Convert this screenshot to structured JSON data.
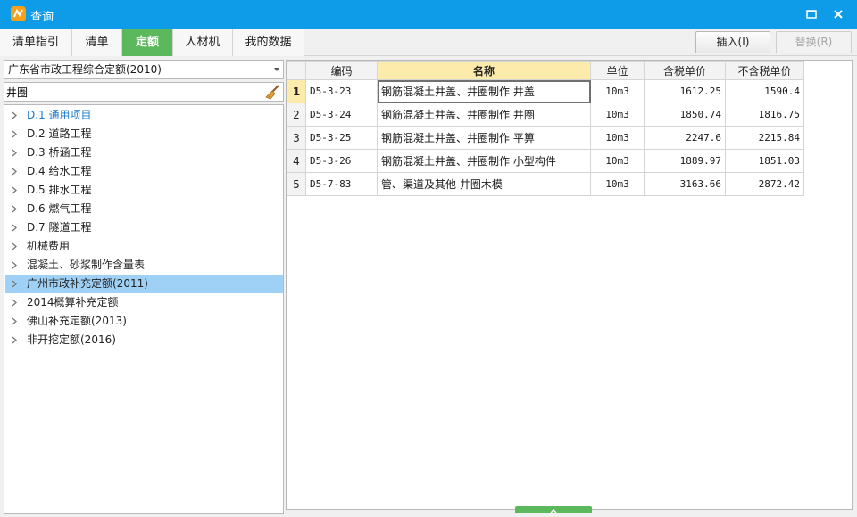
{
  "window": {
    "title": "查询"
  },
  "tabs": [
    {
      "label": "清单指引"
    },
    {
      "label": "清单"
    },
    {
      "label": "定额"
    },
    {
      "label": "人材机"
    },
    {
      "label": "我的数据"
    }
  ],
  "toolbar": {
    "insert_label": "插入(I)",
    "replace_label": "替换(R)"
  },
  "library_select": {
    "value": "广东省市政工程综合定额(2010)"
  },
  "search": {
    "value": "井圈"
  },
  "tree": {
    "items": [
      {
        "label": "D.1 通用项目"
      },
      {
        "label": "D.2 道路工程"
      },
      {
        "label": "D.3 桥涵工程"
      },
      {
        "label": "D.4 给水工程"
      },
      {
        "label": "D.5 排水工程"
      },
      {
        "label": "D.6 燃气工程"
      },
      {
        "label": "D.7 隧道工程"
      },
      {
        "label": "机械费用"
      },
      {
        "label": "混凝土、砂浆制作含量表"
      },
      {
        "label": "广州市政补充定额(2011)"
      },
      {
        "label": "2014概算补充定额"
      },
      {
        "label": "佛山补充定额(2013)"
      },
      {
        "label": "非开挖定额(2016)"
      }
    ]
  },
  "table": {
    "headers": {
      "code": "编码",
      "name": "名称",
      "unit": "单位",
      "price_tax": "含税单价",
      "price_notax": "不含税单价"
    },
    "rows": [
      {
        "num": "1",
        "code": "D5-3-23",
        "name": "钢筋混凝土井盖、井圈制作 井盖",
        "unit": "10m3",
        "price_tax": "1612.25",
        "price_notax": "1590.4"
      },
      {
        "num": "2",
        "code": "D5-3-24",
        "name": "钢筋混凝土井盖、井圈制作 井圈",
        "unit": "10m3",
        "price_tax": "1850.74",
        "price_notax": "1816.75"
      },
      {
        "num": "3",
        "code": "D5-3-25",
        "name": "钢筋混凝土井盖、井圈制作 平箅",
        "unit": "10m3",
        "price_tax": "2247.6",
        "price_notax": "2215.84"
      },
      {
        "num": "4",
        "code": "D5-3-26",
        "name": "钢筋混凝土井盖、井圈制作 小型构件",
        "unit": "10m3",
        "price_tax": "1889.97",
        "price_notax": "1851.03"
      },
      {
        "num": "5",
        "code": "D5-7-83",
        "name": "管、渠道及其他 井圈木模",
        "unit": "10m3",
        "price_tax": "3163.66",
        "price_notax": "2872.42"
      }
    ]
  },
  "colors": {
    "titlebar": "#0e9be8",
    "active_tab": "#5cb85c",
    "selected_tree": "#9fd0f5",
    "sorted_header": "#fcebaa"
  }
}
